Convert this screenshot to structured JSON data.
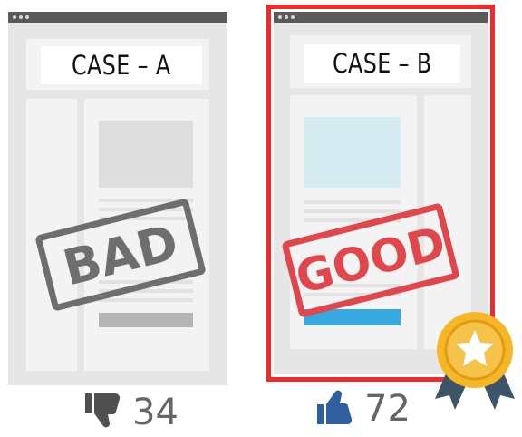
{
  "case_a": {
    "label": "CASE – A",
    "stamp": "BAD",
    "votes": "34",
    "icon": "thumbs-down-icon"
  },
  "case_b": {
    "label": "CASE – B",
    "stamp": "GOOD",
    "votes": "72",
    "icon": "thumbs-up-icon"
  },
  "badge": "award-medal-star-icon",
  "colors": {
    "bad_stamp": "#6e6e6e",
    "good_stamp": "#e0474c",
    "highlight_border": "#ee2a2a",
    "thumb_down": "#505050",
    "thumb_up": "#2f5f9e",
    "accent_blue": "#36a9e1",
    "medal_gold": "#f4b728",
    "ribbon": "#3d5566"
  }
}
